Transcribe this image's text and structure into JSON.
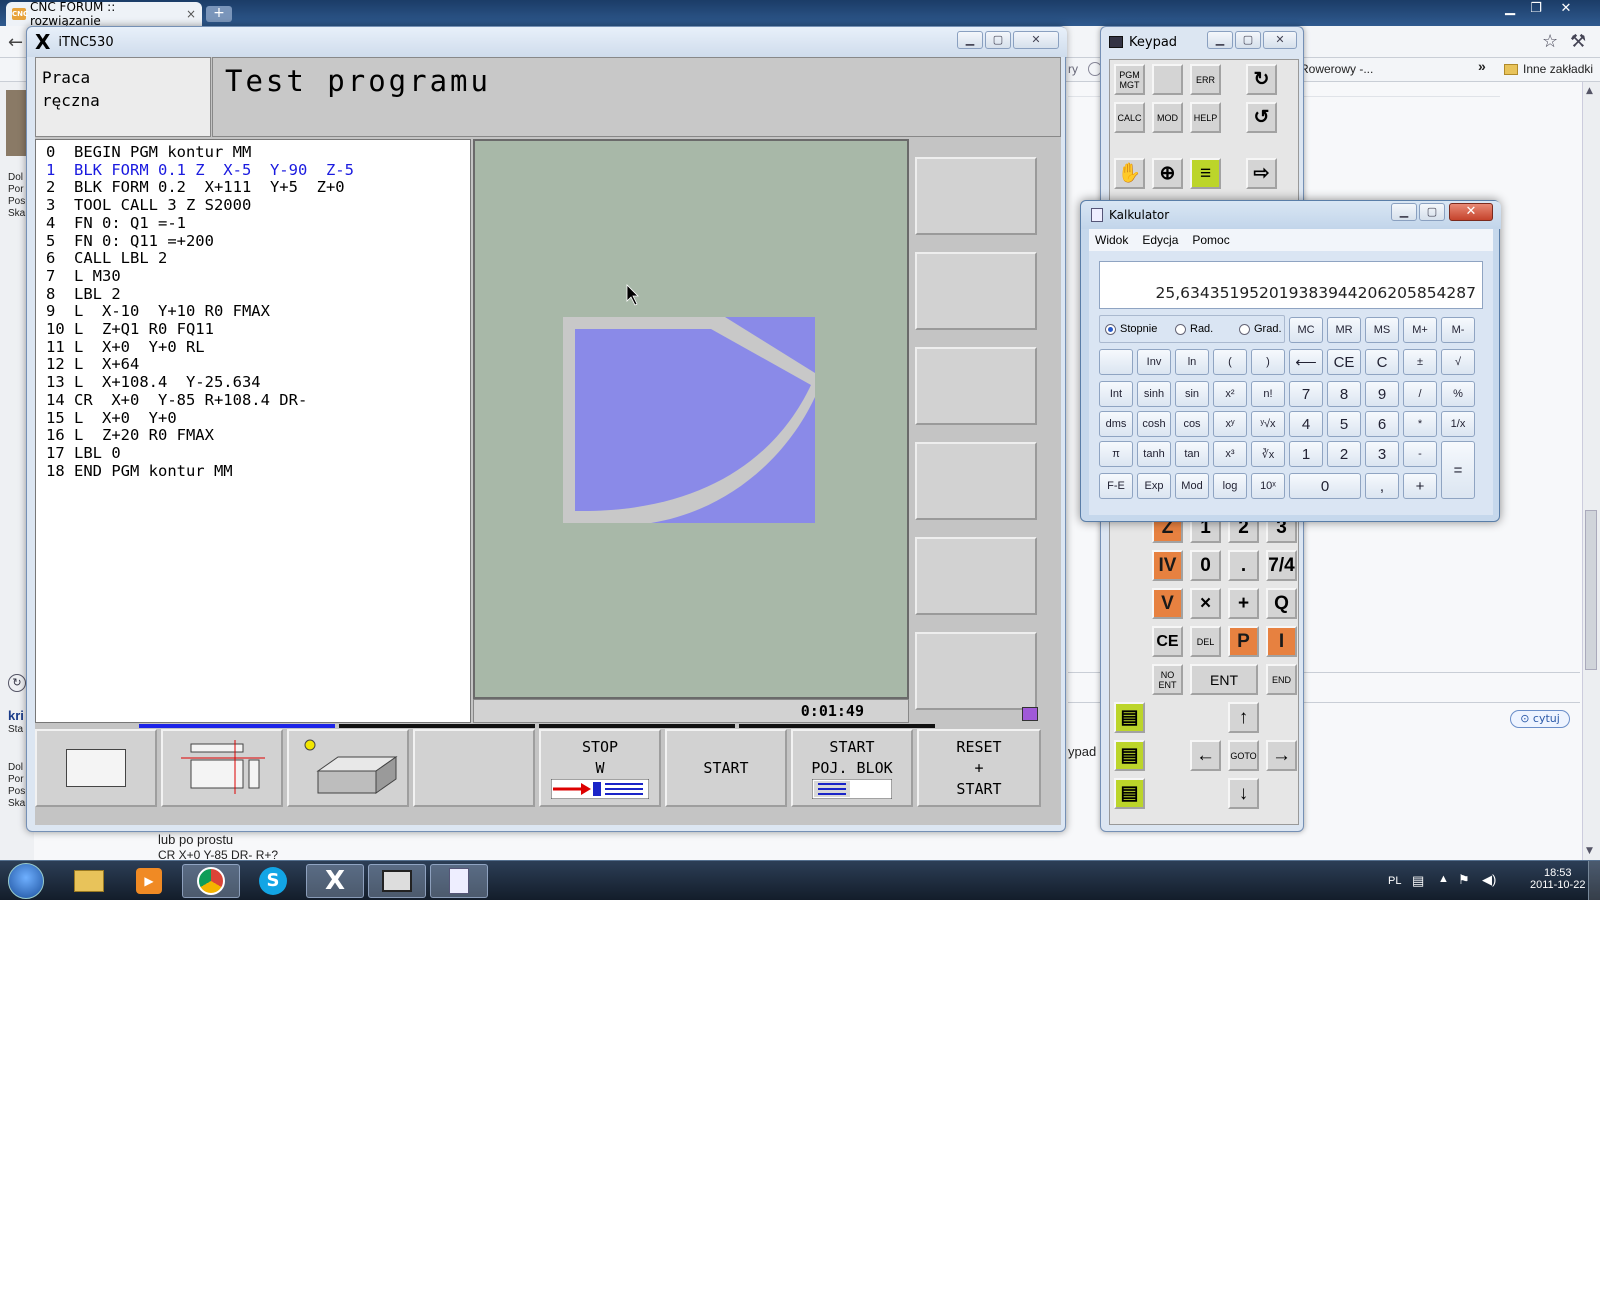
{
  "browser": {
    "tab_title": "CNC FORUM :: rozwiązanie",
    "tab_close": "×",
    "new_tab": "+",
    "bookmark_partial": "Rowerowy -...",
    "bookmark_overflow": "»",
    "other_bookmarks": "Inne zakładki",
    "page_fragments": [
      "ry",
      "ypad",
      "cytuj",
      "kri",
      "Sta",
      "Por",
      "Dol",
      "Pos",
      "Ska"
    ],
    "post_line1": "lub po prostu",
    "post_line2": "CR X+0 Y-85 DR- R+?"
  },
  "itnc": {
    "window_title": "iTNC530",
    "mode_left_line1": "Praca",
    "mode_left_line2": "ręczna",
    "mode_right": "Test programu",
    "program_lines": [
      "0  BEGIN PGM kontur MM",
      "1  BLK FORM 0.1 Z  X-5  Y-90  Z-5",
      "2  BLK FORM 0.2  X+111  Y+5  Z+0",
      "3  TOOL CALL 3 Z S2000",
      "4  FN 0: Q1 =-1",
      "5  FN 0: Q11 =+200",
      "6  CALL LBL 2",
      "7  L M30",
      "8  LBL 2",
      "9  L  X-10  Y+10 R0 FMAX",
      "10 L  Z+Q1 R0 FQ11",
      "11 L  X+0  Y+0 RL",
      "12 L  X+64",
      "13 L  X+108.4  Y-25.634",
      "14 CR  X+0  Y-85 R+108.4 DR-",
      "15 L  X+0  Y+0",
      "16 L  Z+20 R0 FMAX",
      "17 LBL 0",
      "18 END PGM kontur MM"
    ],
    "active_line": 1,
    "run_time": "0:01:49",
    "softkeys": {
      "stop_line1": "STOP",
      "stop_line2": "W",
      "start": "START",
      "start_single_line1": "START",
      "start_single_line2": "POJ. BLOK",
      "reset_line1": "RESET",
      "reset_line2": "+",
      "reset_line3": "START"
    }
  },
  "keypad": {
    "window_title": "Keypad",
    "pgm_mgt": "PGM MGT",
    "err": "ERR",
    "calc": "CALC",
    "mod": "MOD",
    "help": "HELP",
    "keys_row_z": [
      "Z",
      "1",
      "2",
      "3"
    ],
    "keys_row_iv": [
      "IV",
      "0",
      ".",
      "7/4"
    ],
    "keys_row_v": [
      "V",
      "×",
      "+",
      "Q"
    ],
    "keys_row_ce": [
      "CE",
      "DEL",
      "P",
      "I"
    ],
    "no_ent": "NO ENT",
    "ent": "ENT",
    "end": "END",
    "goto": "GOTO",
    "arrow_up": "↑",
    "arrow_left": "←",
    "arrow_right": "→",
    "arrow_down": "↓"
  },
  "calculator": {
    "window_title": "Kalkulator",
    "menu": [
      "Widok",
      "Edycja",
      "Pomoc"
    ],
    "display": "25,634351952019383944206205854287",
    "radio": [
      "Stopnie",
      "Rad.",
      "Grad."
    ],
    "radio_selected": 0,
    "memory": [
      "MC",
      "MR",
      "MS",
      "M+",
      "M-"
    ],
    "row1": [
      "",
      "Inv",
      "ln",
      "(",
      ")",
      "⟵",
      "CE",
      "C",
      "±",
      "√"
    ],
    "row2": [
      "Int",
      "sinh",
      "sin",
      "x²",
      "n!",
      "7",
      "8",
      "9",
      "/",
      "%"
    ],
    "row3": [
      "dms",
      "cosh",
      "cos",
      "xʸ",
      "ʸ√x",
      "4",
      "5",
      "6",
      "*",
      "1/x"
    ],
    "row4": [
      "π",
      "tanh",
      "tan",
      "x³",
      "∛x",
      "1",
      "2",
      "3",
      "-",
      "="
    ],
    "row5": [
      "F-E",
      "Exp",
      "Mod",
      "log",
      "10ˣ",
      "0",
      ",",
      "+"
    ]
  },
  "taskbar": {
    "lang": "PL",
    "time": "18:53",
    "date": "2011-10-22"
  }
}
